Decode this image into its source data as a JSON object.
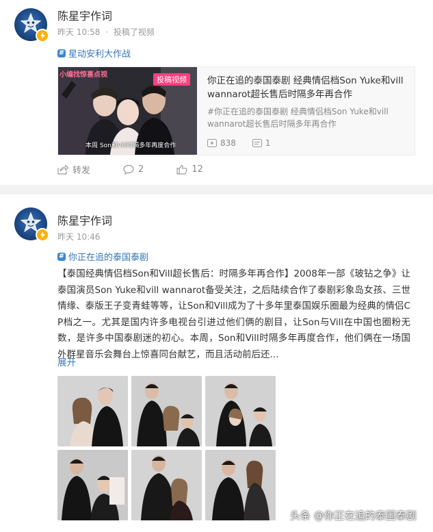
{
  "posts": [
    {
      "author": "陈星宇作词",
      "time": "昨天 10:58",
      "dot": "·",
      "source": "投稿了视频",
      "topic": "星动安利大作战",
      "card": {
        "thumb_badge": "投稿视频",
        "thumb_left_text": "小编找惊喜点视",
        "thumb_subtitle": "本周 Son和Vill时隔多年再度合作",
        "title": "你正在追的泰国泰剧 经典情侣档Son Yuke和vill wannarot超长售后时隔多年再合作",
        "desc": "#你正在追的泰国泰剧 经典情侣档Son Yuke和vill wannarot超长售后时隔多年再合作",
        "views": "838",
        "comments": "1"
      },
      "actions": {
        "repost": "转发",
        "comments": "2",
        "likes": "12"
      }
    },
    {
      "author": "陈星宇作词",
      "time": "昨天 10:46",
      "topic": "你正在追的泰国泰剧",
      "text": "【泰国经典情侣档Son和Vill超长售后：时隔多年再合作】2008年一部《玻钻之争》让泰国演员Son Yuke和vill wannarot备受关注，之后陆续合作了泰剧彩象岛女孩、三世情缘、泰版王子变青蛙等等，让Son和Vill成为了十多年里泰国娱乐圈最为经典的情侣CP档之一。尤其是国内许多电视台引进过他们俩的剧目，让Son与Vill在中国也圈粉无数，是许多中国泰剧迷的初心。本周，Son和Vill时隔多年再度合作，他们俩在一场国外群星音乐会舞台上惊喜同台献艺，而且活动前后还...",
      "expand": "展开"
    }
  ],
  "watermark": "头条 @你正在追的泰国泰剧",
  "colors": {
    "link": "#3576b5",
    "muted": "#999999",
    "badge": "#ffb000",
    "avatar": "#1d4a86"
  },
  "icons": [
    "star-logo-icon",
    "verified-icon",
    "topic-hash-icon",
    "play-icon",
    "comment-icon",
    "repost-icon",
    "like-icon"
  ]
}
